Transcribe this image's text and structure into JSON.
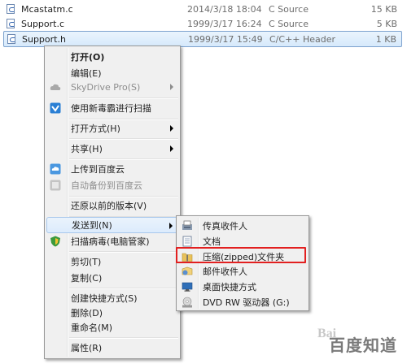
{
  "files": [
    {
      "name": "Mcastatm.c",
      "date": "2014/3/18 18:04",
      "type": "C Source",
      "size": "15 KB",
      "selected": false
    },
    {
      "name": "Support.c",
      "date": "1999/3/17 16:24",
      "type": "C Source",
      "size": "5 KB",
      "selected": false
    },
    {
      "name": "Support.h",
      "date": "1999/3/17 15:49",
      "type": "C/C++ Header",
      "size": "1 KB",
      "selected": true
    }
  ],
  "context_menu": {
    "open": "打开(O)",
    "edit": "编辑(E)",
    "skydrive": "SkyDrive Pro(S)",
    "scan_new": "使用新毒霸进行扫描",
    "open_with": "打开方式(H)",
    "share": "共享(H)",
    "upload_baidu": "上传到百度云",
    "auto_backup_baidu": "自动备份到百度云",
    "restore_previous": "还原以前的版本(V)",
    "send_to": "发送到(N)",
    "scan_virus": "扫描病毒(电脑管家)",
    "cut": "剪切(T)",
    "copy": "复制(C)",
    "create_shortcut": "创建快捷方式(S)",
    "delete": "删除(D)",
    "rename": "重命名(M)",
    "properties": "属性(R)"
  },
  "send_to_menu": {
    "fax": "传真收件人",
    "documents": "文档",
    "zip": "压缩(zipped)文件夹",
    "mail": "邮件收件人",
    "desktop": "桌面快捷方式",
    "dvd": "DVD RW 驱动器 (G:)"
  },
  "watermark": {
    "text": "百度知道",
    "logo": "Bai"
  },
  "colors": {
    "selection_border": "#7da2ce",
    "highlight_box": "#e22020",
    "menu_bg": "#f0f0f0"
  }
}
